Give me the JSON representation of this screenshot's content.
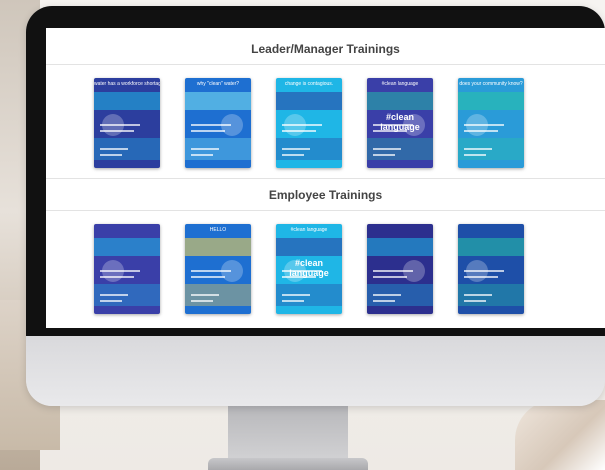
{
  "section_1": {
    "title": "Leader/Manager Trainings",
    "posters": [
      {
        "headline": "water has a workforce shortage.",
        "bg": "#2c3e9e",
        "accent": "#1fb6e6",
        "variant": "a"
      },
      {
        "headline": "why \"clean\" water?",
        "bg": "#1e6fd1",
        "accent": "#7be3f2",
        "variant": "b"
      },
      {
        "headline": "change is contagious.",
        "bg": "#1fb6e6",
        "accent": "#2c3e9e",
        "variant": "c"
      },
      {
        "headline": "#clean language",
        "bg": "#3a3fa8",
        "accent": "#22b8a8",
        "variant": "d"
      },
      {
        "headline": "does your community know?",
        "bg": "#2a9bd8",
        "accent": "#27c4a8",
        "variant": "e"
      }
    ]
  },
  "section_2": {
    "title": "Employee Trainings",
    "posters": [
      {
        "headline": "",
        "bg": "#3a3fa8",
        "accent": "#1fb6e6",
        "variant": "f"
      },
      {
        "headline": "HELLO",
        "bg": "#1e6fd1",
        "accent": "#ffd84d",
        "variant": "g"
      },
      {
        "headline": "#clean language",
        "bg": "#1fb6e6",
        "accent": "#2c3e9e",
        "variant": "h"
      },
      {
        "headline": "",
        "bg": "#2c2f8e",
        "accent": "#1fb6e6",
        "variant": "i"
      },
      {
        "headline": "",
        "bg": "#1e4fa8",
        "accent": "#27c4a8",
        "variant": "j"
      }
    ]
  }
}
